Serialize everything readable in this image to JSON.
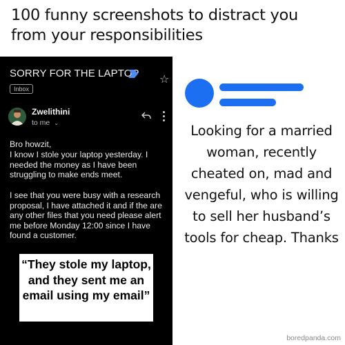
{
  "header": {
    "title": "100 funny screenshots to distract you from your responsibilities"
  },
  "email": {
    "subject": "SORRY FOR THE LAPTOP",
    "label": "Inbox",
    "sender": "Zwelithini",
    "recipient": "to me",
    "greeting": "Bro howzit,",
    "paragraph1": "I know I stole your laptop yesterday. I needed the money as I have been struggling to make ends meet.",
    "paragraph2": "I see that you were busy with a research proposal, I have attached it and if the are any other files that you need please alert me before Monday 12:00 since I have found a customer.",
    "caption": "“They stole my laptop, and they sent me an email using my email”",
    "colors": {
      "background": "#000000",
      "text": "#ececec",
      "accent": "#4d8cf5"
    }
  },
  "post": {
    "text": "Looking for a married woman, recently cheated on, mad and vengeful, who is willing to sell her husband’s tools for cheap. Thanks",
    "icon_color": "#1c6ff0"
  },
  "watermark": "boredpanda.com"
}
